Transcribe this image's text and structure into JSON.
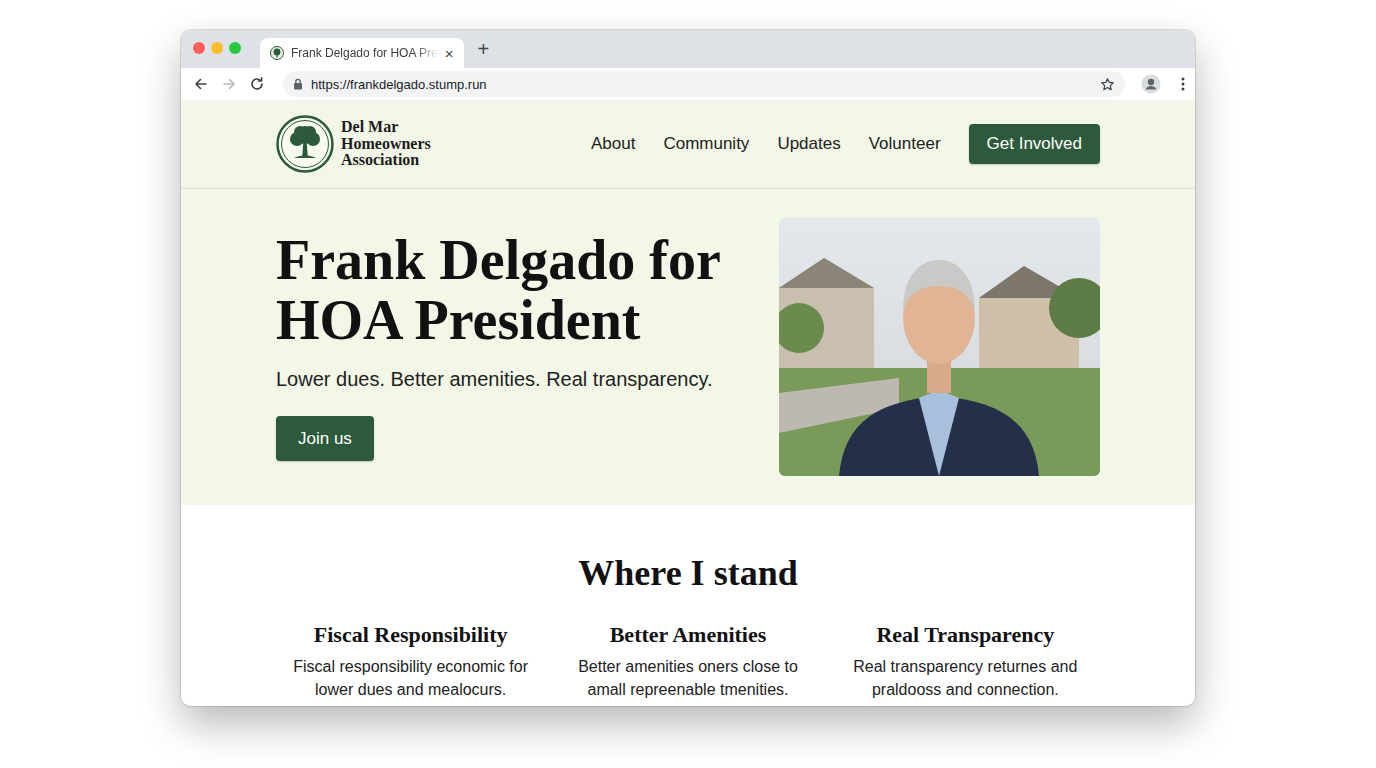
{
  "window": {
    "title": "Frank Delgado for HOA Pre",
    "close": "×",
    "new_tab": "+",
    "url": "https://frankdelgado.stump.run"
  },
  "site": {
    "logo": [
      "Del Mar",
      "Homeowners",
      "Association"
    ],
    "nav": [
      {
        "label": "About"
      },
      {
        "label": "Community"
      },
      {
        "label": "Updates"
      },
      {
        "label": "Volunteer"
      }
    ],
    "cta": "Get Involved"
  },
  "hero": {
    "title": "Frank Delgado for HOA President",
    "tagline": "Lower dues. Better amenities. Real transparency.",
    "button": "Join us"
  },
  "positions": {
    "heading": "Where I stand",
    "items": [
      {
        "title": "Fiscal Responsibility",
        "text": [
          "Fiscal responsibility economic for",
          "lower dues and mealocurs."
        ]
      },
      {
        "title": "Better Amenities",
        "text": [
          "Better amenities oners close to",
          "amall repreenable tmenities."
        ]
      },
      {
        "title": "Real Transparency",
        "text": [
          "Real transparency returnes and",
          "praldooss and connection."
        ]
      }
    ]
  }
}
